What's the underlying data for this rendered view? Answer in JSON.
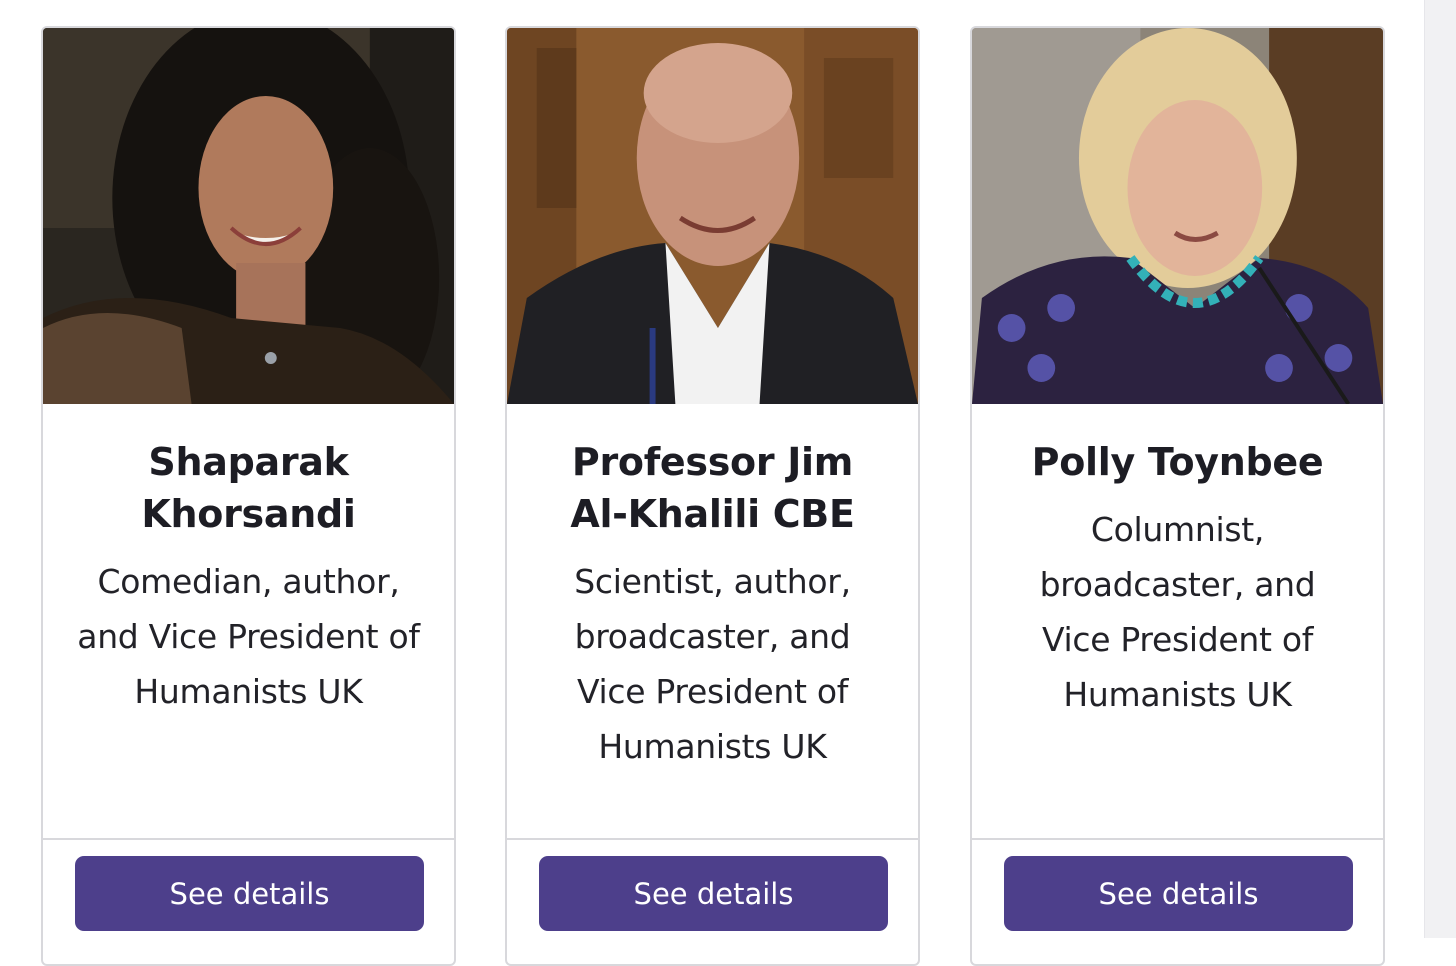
{
  "people": [
    {
      "name": "Shaparak Khorsandi",
      "role": "Comedian, author, and Vice President of Humanists UK",
      "button_label": "See details"
    },
    {
      "name": "Professor Jim Al-Khalili CBE",
      "role": "Scientist, author, broadcaster, and Vice President of Humanists UK",
      "button_label": "See details"
    },
    {
      "name": "Polly Toynbee",
      "role": "Columnist, broadcaster, and Vice President of Humanists UK",
      "button_label": "See details"
    }
  ],
  "colors": {
    "button": "#4d3f8b",
    "border": "#d8d8dc",
    "text": "#1d1d24"
  }
}
